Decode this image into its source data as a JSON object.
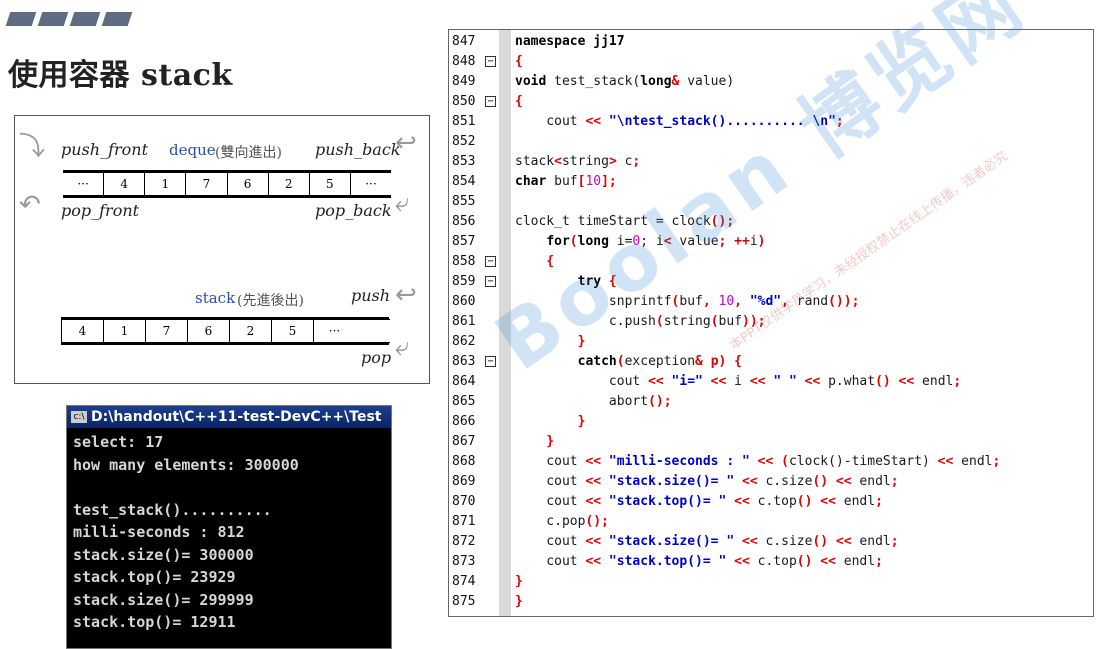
{
  "title": "使用容器 stack",
  "diagram": {
    "push_front": "push_front",
    "deque_name": "deque",
    "deque_note": "(雙向進出)",
    "push_back": "push_back",
    "pop_front": "pop_front",
    "pop_back": "pop_back",
    "deque_cells": [
      "···",
      "4",
      "1",
      "7",
      "6",
      "2",
      "5",
      "···"
    ],
    "stack_name": "stack",
    "stack_note": "(先進後出)",
    "push": "push",
    "pop": "pop",
    "stack_cells": [
      "4",
      "1",
      "7",
      "6",
      "2",
      "5",
      "···"
    ]
  },
  "console": {
    "icon": "c:\\",
    "title": "D:\\handout\\C++11-test-DevC++\\Test",
    "lines": [
      "select: 17",
      "how many elements: 300000",
      "",
      "test_stack()..........",
      "milli-seconds : 812",
      "stack.size()= 300000",
      "stack.top()= 23929",
      "stack.size()= 299999",
      "stack.top()= 12911"
    ]
  },
  "code": {
    "rows": [
      {
        "ln": "847",
        "fold": ""
      },
      {
        "ln": "848",
        "fold": "−"
      },
      {
        "ln": "849",
        "fold": ""
      },
      {
        "ln": "850",
        "fold": "−"
      },
      {
        "ln": "851",
        "fold": ""
      },
      {
        "ln": "852",
        "fold": ""
      },
      {
        "ln": "853",
        "fold": ""
      },
      {
        "ln": "854",
        "fold": ""
      },
      {
        "ln": "855",
        "fold": ""
      },
      {
        "ln": "856",
        "fold": ""
      },
      {
        "ln": "857",
        "fold": ""
      },
      {
        "ln": "858",
        "fold": "−"
      },
      {
        "ln": "859",
        "fold": "−"
      },
      {
        "ln": "860",
        "fold": ""
      },
      {
        "ln": "861",
        "fold": ""
      },
      {
        "ln": "862",
        "fold": ""
      },
      {
        "ln": "863",
        "fold": "−"
      },
      {
        "ln": "864",
        "fold": ""
      },
      {
        "ln": "865",
        "fold": ""
      },
      {
        "ln": "866",
        "fold": ""
      },
      {
        "ln": "867",
        "fold": ""
      },
      {
        "ln": "868",
        "fold": ""
      },
      {
        "ln": "869",
        "fold": ""
      },
      {
        "ln": "870",
        "fold": ""
      },
      {
        "ln": "871",
        "fold": ""
      },
      {
        "ln": "872",
        "fold": ""
      },
      {
        "ln": "873",
        "fold": ""
      },
      {
        "ln": "874",
        "fold": ""
      },
      {
        "ln": "875",
        "fold": ""
      }
    ],
    "lines": {
      "l847": "namespace jj17",
      "l848": "{",
      "l849a": "void",
      "l849b": " test_stack(",
      "l849c": "long",
      "l849d": "&",
      "l849e": " value)",
      "l850": "{",
      "l851a": "    cout ",
      "l851b": "<<",
      "l851c": " \"\\ntest_stack().......... \\n\"",
      "l851d": ";",
      "l853a": "stack",
      "l853b": "<",
      "l853c": "string",
      "l853d": ">",
      "l853e": " c",
      "l853f": ";",
      "l854a": "char",
      "l854b": " buf",
      "l854c": "[",
      "l854d": "10",
      "l854e": "];",
      "l856a": "clock_t timeStart = clock",
      "l856b": "();",
      "l857a": "    ",
      "l857b": "for",
      "l857c": "(",
      "l857d": "long",
      "l857e": " i=",
      "l857f": "0",
      "l857g": "; i",
      "l857h": "<",
      "l857i": " value",
      "l857j": "; ++",
      "l857k": "i",
      "l857l": ")",
      "l858": "    {",
      "l859a": "        ",
      "l859b": "try",
      "l859c": " {",
      "l860a": "            snprintf",
      "l860b": "(",
      "l860c": "buf",
      "l860d": ", ",
      "l860e": "10",
      "l860f": ", ",
      "l860g": "\"%d\"",
      "l860h": ", ",
      "l860i": "rand",
      "l860j": "());",
      "l861a": "            c.push",
      "l861b": "(",
      "l861c": "string",
      "l861d": "(",
      "l861e": "buf",
      "l861f": "));",
      "l862": "        }",
      "l863a": "        ",
      "l863b": "catch",
      "l863c": "(",
      "l863d": "exception",
      "l863e": "&",
      "l863f": " p) {",
      "l864a": "            cout ",
      "l864b": "<<",
      "l864c": " \"i=\"",
      "l864d": " << ",
      "l864e": "i",
      "l864f": " << ",
      "l864g": "\" \"",
      "l864h": " << ",
      "l864i": "p.what",
      "l864j": "()",
      "l864k": " << ",
      "l864l": "endl",
      "l864m": ";",
      "l865a": "            abort",
      "l865b": "();",
      "l866": "        }",
      "l867": "    }",
      "l868a": "    cout ",
      "l868b": "<<",
      "l868c": " \"milli-seconds : \"",
      "l868d": " << (",
      "l868e": "clock",
      "l868f": "()-timeStart)",
      "l868g": " << ",
      "l868h": "endl",
      "l868i": ";",
      "l869a": "    cout ",
      "l869b": "<<",
      "l869c": " \"stack.size()= \"",
      "l869d": " << ",
      "l869e": "c.size",
      "l869f": "()",
      "l869g": " << ",
      "l869h": "endl",
      "l869i": ";",
      "l870a": "    cout ",
      "l870b": "<<",
      "l870c": " \"stack.top()= \"",
      "l870d": " << ",
      "l870e": "c.top",
      "l870f": "()",
      "l870g": " << ",
      "l870h": "endl",
      "l870i": ";",
      "l871a": "    c.pop",
      "l871b": "();",
      "l872a": "    cout ",
      "l872b": "<<",
      "l872c": " \"stack.size()= \"",
      "l872d": " << ",
      "l872e": "c.size",
      "l872f": "()",
      "l872g": " << ",
      "l872h": "endl",
      "l872i": ";",
      "l873a": "    cout ",
      "l873b": "<<",
      "l873c": " \"stack.top()= \"",
      "l873d": " << ",
      "l873e": "c.top",
      "l873f": "()",
      "l873g": " << ",
      "l873h": "endl",
      "l873i": ";",
      "l874": "}",
      "l875": "}"
    }
  },
  "watermark": {
    "main": "Boolan 博览网",
    "sub": "本PPT仅供学员学习，未经授权禁止在线上传播，违者必究"
  }
}
